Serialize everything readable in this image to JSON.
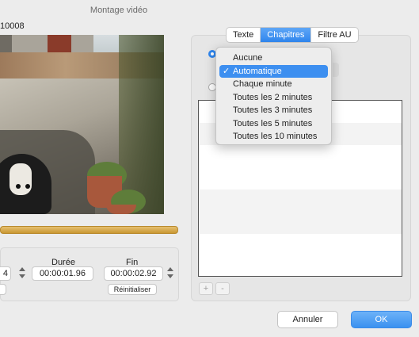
{
  "window": {
    "title": "Montage vidéo",
    "clip_id": "10008"
  },
  "tabs": [
    {
      "label": "Texte",
      "active": false
    },
    {
      "label": "Chapitres",
      "active": true
    },
    {
      "label": "Filtre AU",
      "active": false
    }
  ],
  "chapters_dropdown": {
    "options": [
      "Aucune",
      "Automatique",
      "Chaque minute",
      "Toutes les 2 minutes",
      "Toutes les 3 minutes",
      "Toutes les 5 minutes",
      "Toutes les 10 minutes"
    ],
    "selected": "Automatique",
    "check_glyph": "✓"
  },
  "timing": {
    "start_value_partial": "4",
    "duration_label": "Durée",
    "duration_value": "00:00:01.96",
    "end_label": "Fin",
    "end_value": "00:00:02.92",
    "reset_label": "Réinitialiser"
  },
  "list_controls": {
    "add": "+",
    "remove": "-"
  },
  "buttons": {
    "cancel": "Annuler",
    "ok": "OK"
  },
  "colors": {
    "accent": "#2f86ee",
    "timeline": "#d9aa4a"
  }
}
